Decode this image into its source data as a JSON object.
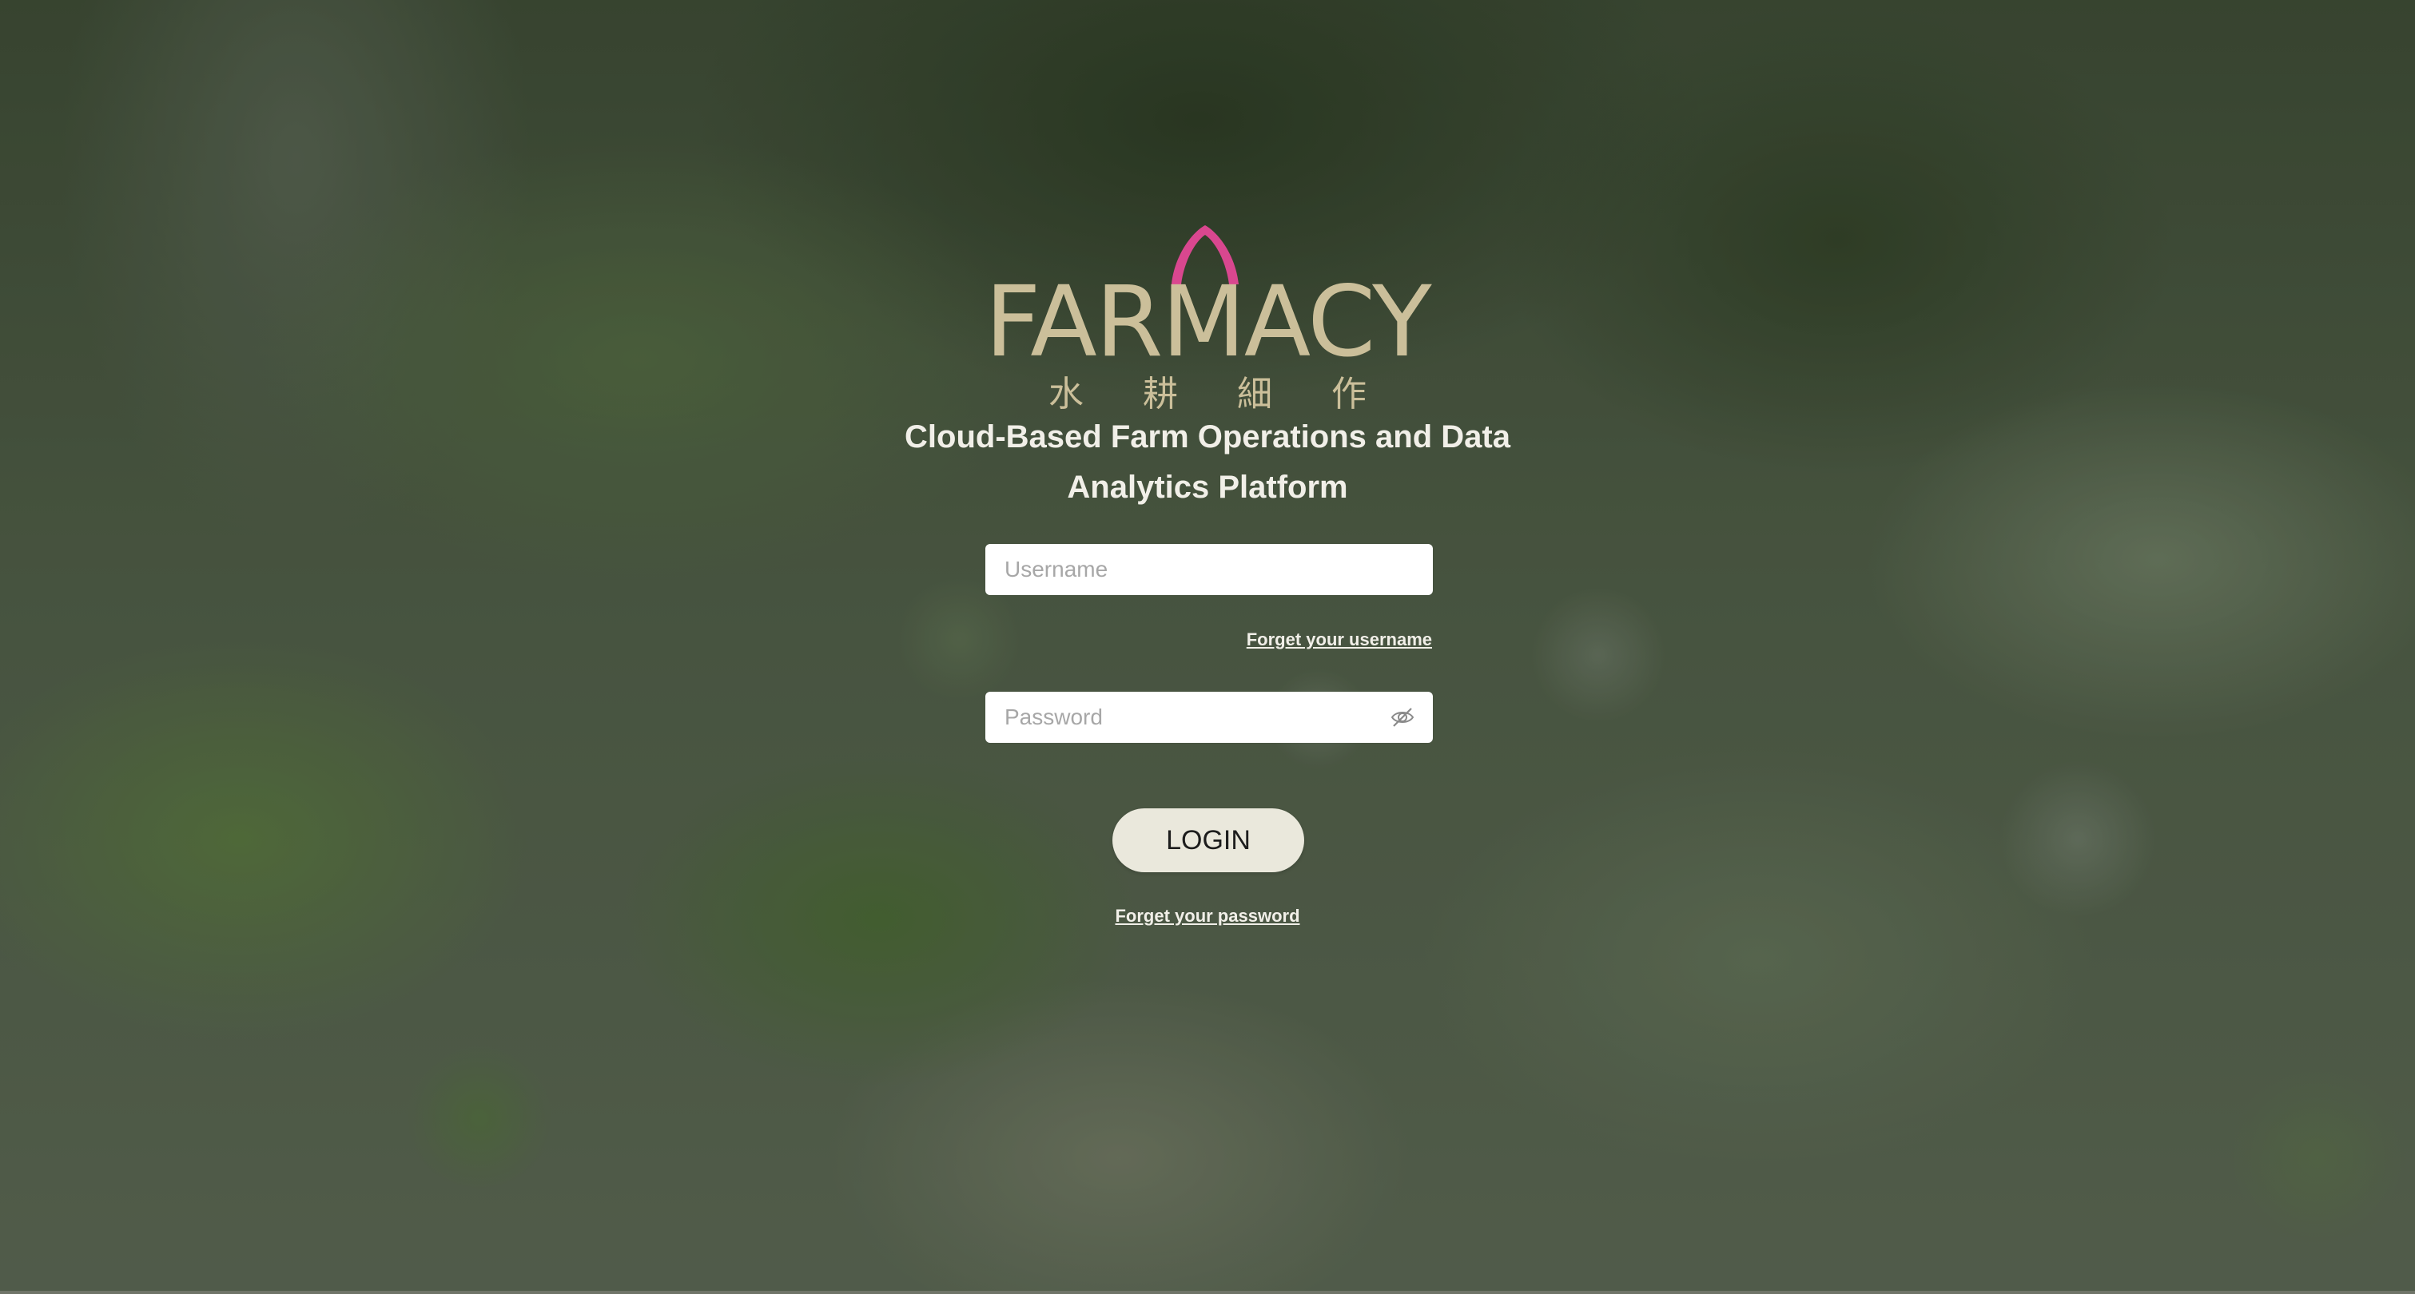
{
  "brand": {
    "logo_text": "FARMACY",
    "logo_chinese": "水 耕 細 作",
    "leaf_color": "#d9478f",
    "text_color": "#cbbf9a"
  },
  "subtitle": "Cloud-Based Farm Operations and Data Analytics Platform",
  "login_form": {
    "username_placeholder": "Username",
    "username_value": "",
    "forgot_username_link": "Forget your username",
    "password_placeholder": "Password",
    "password_value": "",
    "password_toggle_icon": "eye-slash-icon",
    "login_button": "LOGIN",
    "forgot_password_link": "Forget your password"
  }
}
